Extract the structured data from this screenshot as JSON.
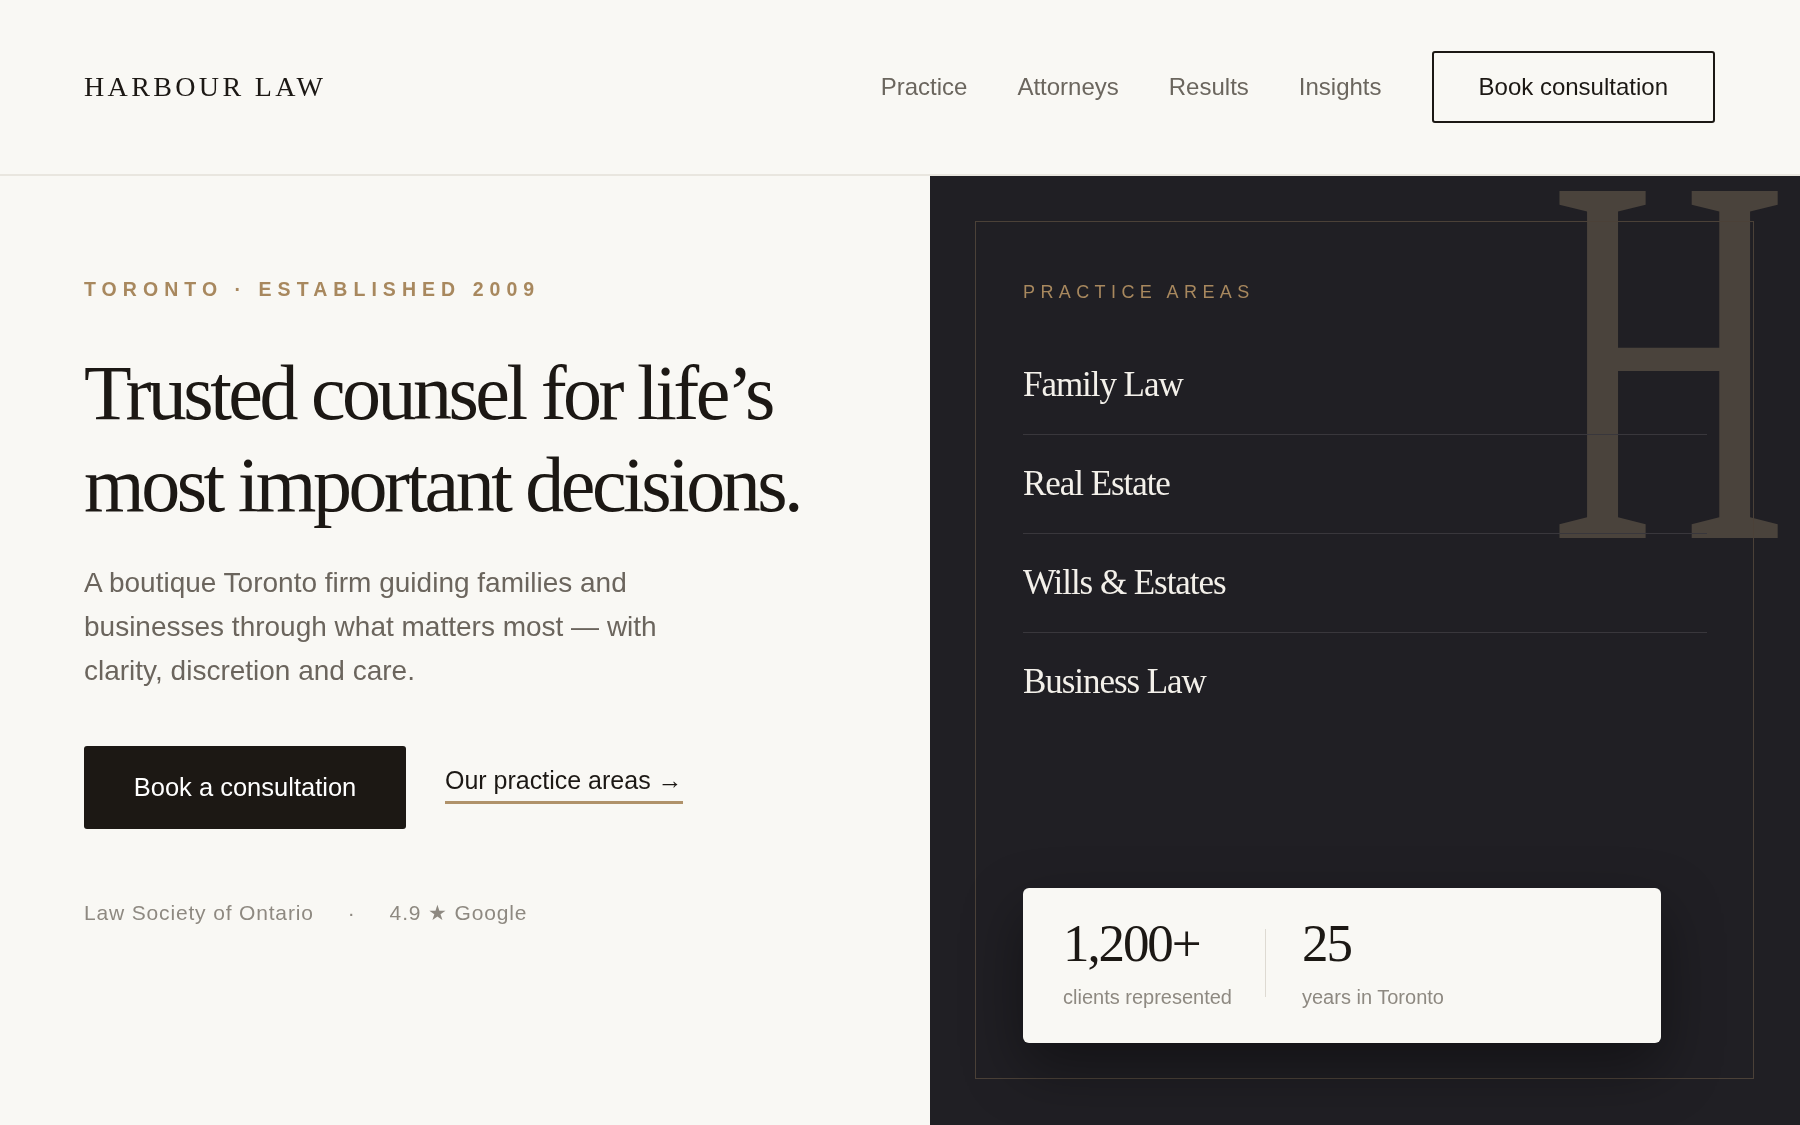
{
  "header": {
    "logo": "HARBOUR LAW",
    "nav": [
      {
        "label": "Practice"
      },
      {
        "label": "Attorneys"
      },
      {
        "label": "Results"
      },
      {
        "label": "Insights"
      }
    ],
    "cta": "Book consultation"
  },
  "hero": {
    "eyebrow": "TORONTO · ESTABLISHED 2009",
    "headline_lines": [
      "Trusted counsel for life’s",
      "most important decisions."
    ],
    "intro": "A boutique Toronto firm guiding families and businesses through what matters most — with clarity, discretion and care.",
    "primary_button": "Book a consultation",
    "secondary_link": "Our practice areas →",
    "trust": [
      "Law Society of Ontario",
      "4.9 ★ Google"
    ],
    "trust_separator": "·"
  },
  "panel": {
    "monogram": "H",
    "eyebrow": "PRACTICE AREAS",
    "areas": [
      "Family Law",
      "Real Estate",
      "Wills & Estates",
      "Business Law"
    ],
    "stats": [
      {
        "value": "1,200+",
        "label": "clients represented"
      },
      {
        "value": "25",
        "label": "years in Toronto"
      }
    ]
  }
}
